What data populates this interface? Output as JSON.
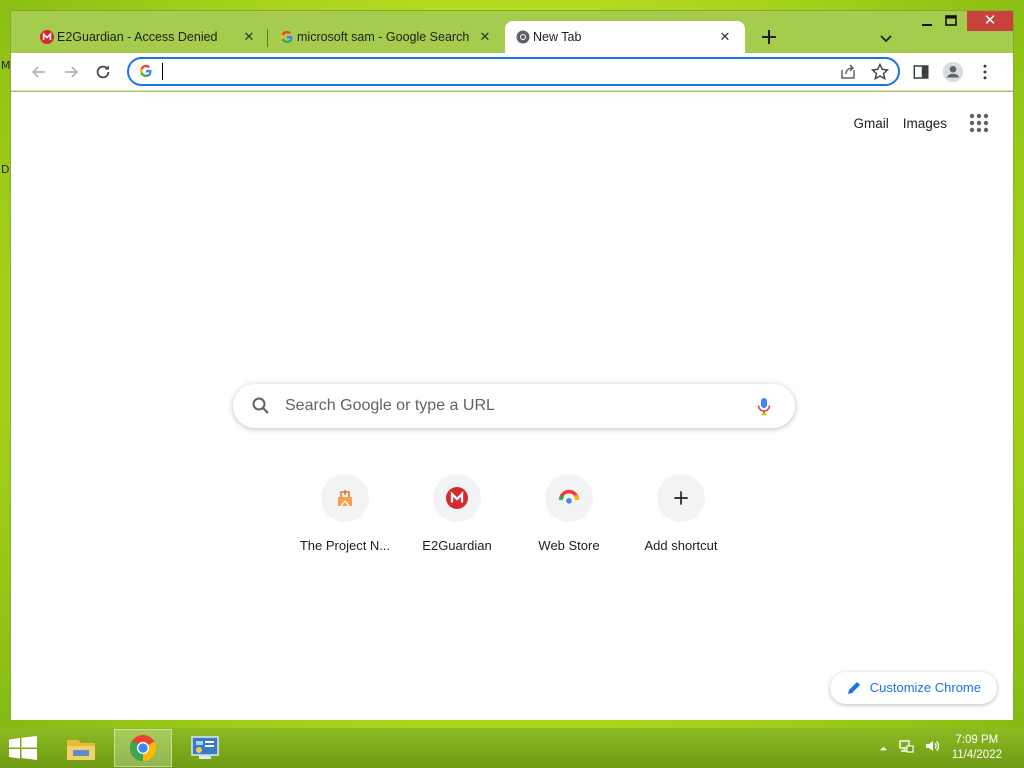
{
  "desktop": {
    "fragments": [
      "M",
      "D"
    ]
  },
  "browser": {
    "tabs": [
      {
        "title": "E2Guardian - Access Denied",
        "favicon": "mega-icon",
        "active": false
      },
      {
        "title": "microsoft sam - Google Search",
        "favicon": "google-g-icon",
        "active": false
      },
      {
        "title": "New Tab",
        "favicon": "chrome-icon",
        "active": true
      }
    ],
    "tab_close_glyph": "✕",
    "window_controls": {
      "close_glyph": "✕"
    },
    "omnibox": {
      "value": ""
    }
  },
  "ntp": {
    "top_links": {
      "gmail": "Gmail",
      "images": "Images"
    },
    "search_placeholder": "Search Google or type a URL",
    "shortcuts": [
      {
        "label": "The Project N...",
        "icon": "project-n-icon"
      },
      {
        "label": "E2Guardian",
        "icon": "mega-icon"
      },
      {
        "label": "Web Store",
        "icon": "webstore-icon"
      },
      {
        "label": "Add shortcut",
        "icon": "plus-icon"
      }
    ],
    "customize_label": "Customize Chrome"
  },
  "taskbar": {
    "apps": [
      "file-explorer-icon",
      "chrome-icon",
      "control-panel-icon"
    ],
    "clock": {
      "time": "7:09 PM",
      "date": "11/4/2022"
    }
  },
  "colors": {
    "accent": "#1a73e8",
    "frame": "#a6cc4d",
    "close": "#c6423b",
    "mega_red": "#d9272e"
  }
}
